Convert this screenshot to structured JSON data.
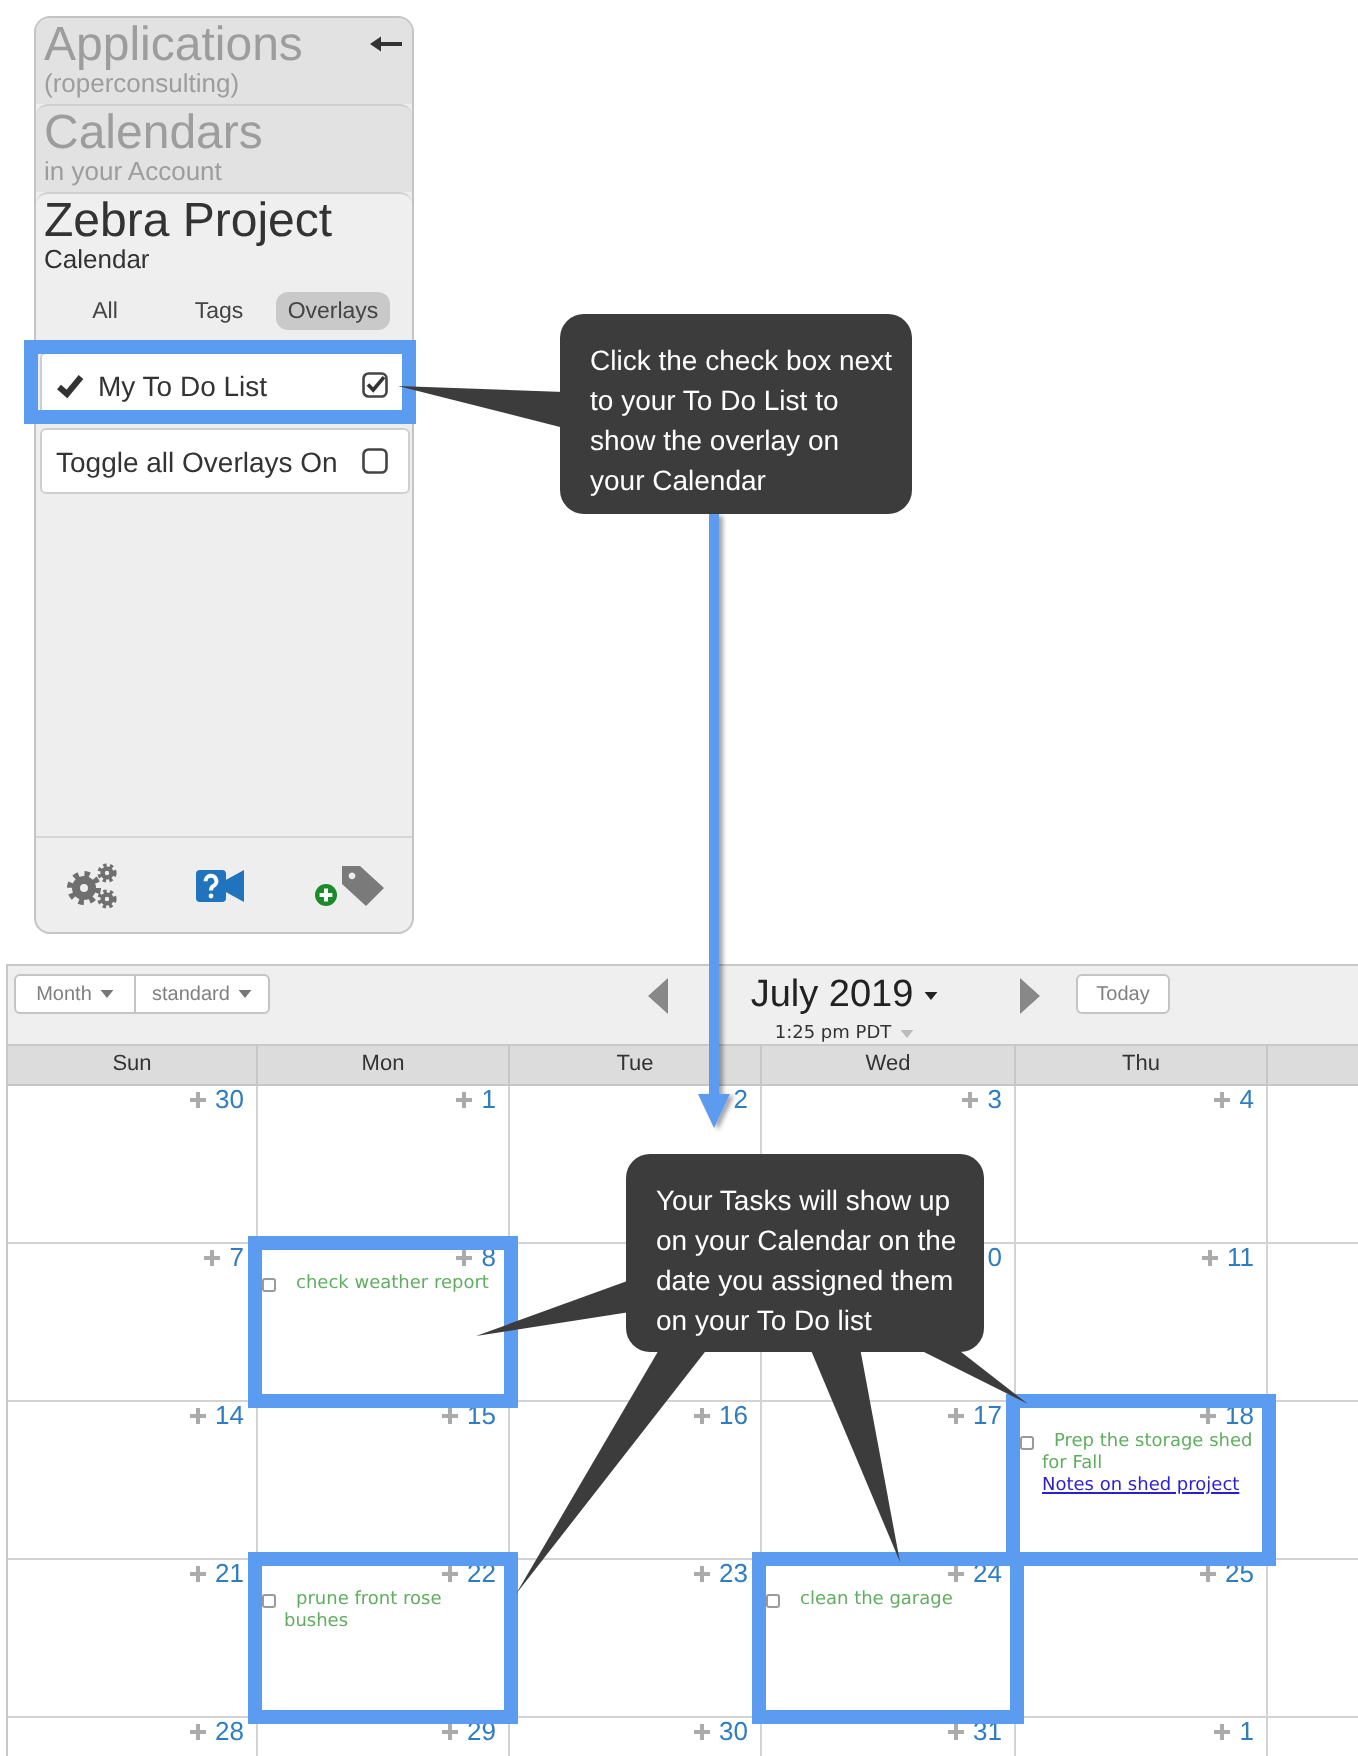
{
  "sidebar": {
    "sections": [
      {
        "title": "Applications",
        "subtitle": "(roperconsulting)",
        "current": false
      },
      {
        "title": "Calendars",
        "subtitle": "in your Account",
        "current": false
      },
      {
        "title": "Zebra Project",
        "subtitle": "Calendar",
        "current": true
      }
    ],
    "tabs": [
      {
        "label": "All",
        "selected": false
      },
      {
        "label": "Tags",
        "selected": false
      },
      {
        "label": "Overlays",
        "selected": true
      }
    ],
    "overlays": [
      {
        "label": "My To Do List",
        "shown": true,
        "checked": true,
        "highlighted": true
      },
      {
        "label": "Toggle all Overlays On",
        "shown": false,
        "checked": false,
        "highlighted": false
      }
    ]
  },
  "calendar": {
    "view_menu": "Month",
    "style_menu": "standard",
    "title": "July 2019",
    "time": "1:25 pm PDT",
    "today_button": "Today",
    "weekdays": [
      "Sun",
      "Mon",
      "Tue",
      "Wed",
      "Thu"
    ],
    "weeks": [
      {
        "days": [
          {
            "day": "30",
            "plus": true,
            "highlighted": false
          },
          {
            "day": "1",
            "plus": true,
            "highlighted": false
          },
          {
            "day": "2",
            "plus": false,
            "highlighted": false
          },
          {
            "day": "3",
            "plus": true,
            "highlighted": false
          },
          {
            "day": "4",
            "plus": true,
            "highlighted": false
          }
        ]
      },
      {
        "days": [
          {
            "day": "7",
            "plus": true,
            "highlighted": false
          },
          {
            "day": "8",
            "plus": true,
            "highlighted": true,
            "tasks": [
              {
                "title": "check weather report",
                "checked": false
              }
            ]
          },
          {
            "plus": false,
            "highlighted": false
          },
          {
            "day": "0",
            "plus": false,
            "highlighted": false
          },
          {
            "day": "11",
            "plus": true,
            "highlighted": false
          }
        ]
      },
      {
        "days": [
          {
            "day": "14",
            "plus": true,
            "highlighted": false
          },
          {
            "day": "15",
            "plus": true,
            "highlighted": false
          },
          {
            "day": "16",
            "plus": true,
            "highlighted": false
          },
          {
            "day": "17",
            "plus": true,
            "highlighted": false
          },
          {
            "day": "18",
            "plus": true,
            "highlighted": true,
            "tasks": [
              {
                "title": "Prep the storage shed for Fall",
                "link": "Notes on shed project",
                "checked": false
              }
            ]
          }
        ]
      },
      {
        "days": [
          {
            "day": "21",
            "plus": true,
            "highlighted": false
          },
          {
            "day": "22",
            "plus": true,
            "highlighted": true,
            "tasks": [
              {
                "title": "prune front rose bushes",
                "checked": false
              }
            ]
          },
          {
            "day": "23",
            "plus": true,
            "highlighted": false
          },
          {
            "day": "24",
            "plus": true,
            "highlighted": true,
            "tasks": [
              {
                "title": "clean the garage",
                "checked": false
              }
            ]
          },
          {
            "day": "25",
            "plus": true,
            "highlighted": false
          }
        ]
      },
      {
        "days": [
          {
            "day": "28",
            "plus": true,
            "highlighted": false
          },
          {
            "day": "29",
            "plus": true,
            "highlighted": false
          },
          {
            "day": "30",
            "plus": true,
            "highlighted": false
          },
          {
            "day": "31",
            "plus": true,
            "highlighted": false
          },
          {
            "day": "1",
            "plus": true,
            "highlighted": false
          }
        ]
      }
    ]
  },
  "callouts": [
    {
      "text": "Click the check box next to your To Do List to show the overlay on your Calendar"
    },
    {
      "text": "Your Tasks will show up on your Calendar on the date you assigned them on your To Do list"
    }
  ]
}
